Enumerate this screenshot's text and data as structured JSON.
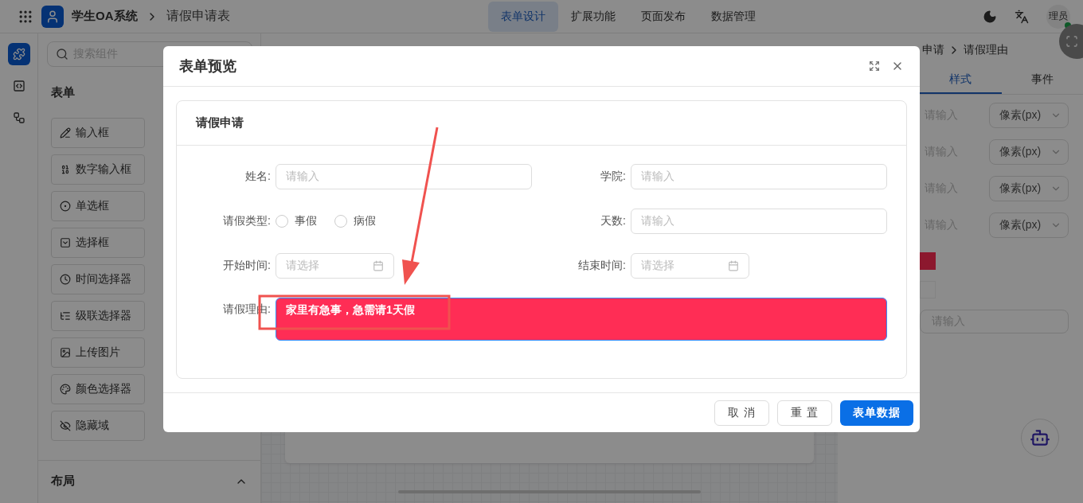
{
  "topbar": {
    "app_name": "学生OA系统",
    "page_title": "请假申请表",
    "nav": [
      {
        "label": "表单设计",
        "selected": true
      },
      {
        "label": "扩展功能",
        "selected": false
      },
      {
        "label": "页面发布",
        "selected": false
      },
      {
        "label": "数据管理",
        "selected": false
      }
    ],
    "avatar": {
      "text": "理员",
      "online": true
    }
  },
  "rail": [
    {
      "selected": true
    },
    {
      "selected": false
    },
    {
      "selected": false
    }
  ],
  "left_panel": {
    "search": {
      "placeholder": "搜索组件"
    },
    "section_title": "表单",
    "components": [
      "输入框",
      "数字输入框",
      "单选框",
      "选择框",
      "时间选择器",
      "级联选择器",
      "上传图片",
      "颜色选择器",
      "隐藏域"
    ],
    "layout_section": {
      "title": "布局",
      "expanded": true
    }
  },
  "right_panel": {
    "breadcrumb": [
      "申请",
      "请假理由"
    ],
    "tabs": [
      {
        "label": "样式",
        "selected": true
      },
      {
        "label": "事件",
        "selected": false
      }
    ],
    "unit_rows": [
      {
        "placeholder": "请输入",
        "unit": "像素(px)"
      },
      {
        "placeholder": "请输入",
        "unit": "像素(px)"
      },
      {
        "placeholder": "请输入",
        "unit": "像素(px)"
      },
      {
        "placeholder": "请输入",
        "unit": "像素(px)"
      }
    ],
    "input": {
      "placeholder": "请输入"
    }
  },
  "dialog": {
    "title": "表单预览",
    "card_title": "请假申请",
    "fields": [
      {
        "kind": "input",
        "label": "姓名:",
        "placeholder": "请输入"
      },
      {
        "kind": "input",
        "label": "学院:",
        "placeholder": "请输入"
      },
      {
        "kind": "radio",
        "label": "请假类型:",
        "options": [
          {
            "label": "事假",
            "selected": false
          },
          {
            "label": "病假",
            "selected": false
          }
        ]
      },
      {
        "kind": "input",
        "label": "天数:",
        "placeholder": "请输入"
      },
      {
        "kind": "date",
        "label": "开始时间:",
        "placeholder": "请选择"
      },
      {
        "kind": "date",
        "label": "结束时间:",
        "placeholder": "请选择"
      },
      {
        "kind": "textarea",
        "label": "请假理由:",
        "value": "家里有急事，急需请1天假"
      }
    ],
    "buttons": [
      {
        "label": "取 消",
        "kind": "default"
      },
      {
        "label": "重 置",
        "kind": "default"
      },
      {
        "label": "表单数据",
        "kind": "primary"
      }
    ]
  }
}
